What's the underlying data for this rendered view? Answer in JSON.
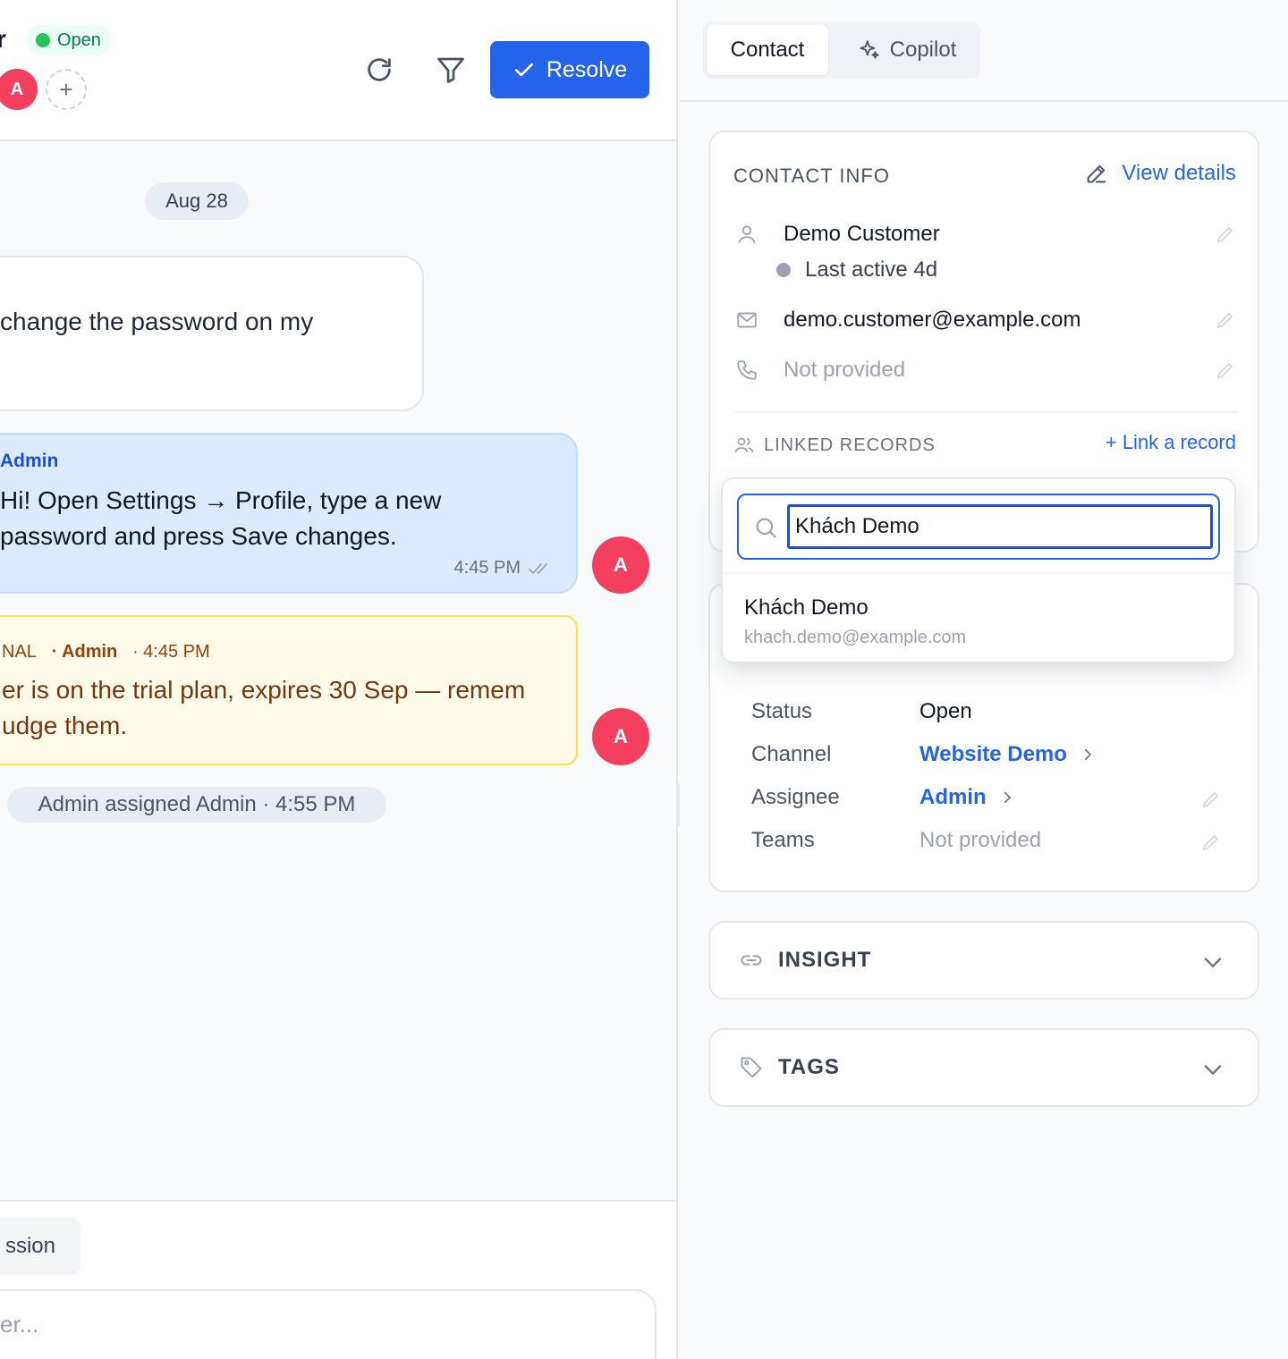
{
  "header": {
    "name_fragment": "r",
    "status": "Open",
    "avatar_initial": "A",
    "add_label": "+",
    "resolve_label": "Resolve"
  },
  "messages": {
    "date_divider": "Aug 28",
    "incoming_text": "change the password on my",
    "outgoing": {
      "sender": "Admin",
      "text": "Hi! Open Settings → Profile, type a new password and press Save changes.",
      "time": "4:45 PM",
      "avatar": "A"
    },
    "note": {
      "label": "NAL",
      "author": "· Admin",
      "time": "· 4:45 PM",
      "line1": "er is on the trial plan, expires 30 Sep — remem",
      "line2": "udge them.",
      "avatar": "A"
    },
    "activity": "Admin assigned Admin · 4:55 PM"
  },
  "composer": {
    "tab_label": "ssion",
    "placeholder": "er..."
  },
  "sidebar": {
    "tabs": [
      {
        "label": "Contact",
        "active": true
      },
      {
        "label": "Copilot",
        "active": false
      }
    ],
    "contact_info": {
      "title": "CONTACT INFO",
      "view_details": "View details",
      "name": "Demo Customer",
      "last_active": "Last active 4d",
      "email": "demo.customer@example.com",
      "phone": "Not provided"
    },
    "linked_records": {
      "title": "LINKED RECORDS",
      "link_action": "+ Link a record",
      "search_value": "Khách Demo",
      "result_name": "Khách Demo",
      "result_email": "khach.demo@example.com"
    },
    "conversation_info": {
      "status_label": "Status",
      "status_value": "Open",
      "channel_label": "Channel",
      "channel_value": "Website Demo",
      "assignee_label": "Assignee",
      "assignee_value": "Admin",
      "teams_label": "Teams",
      "teams_value": "Not provided"
    },
    "insight_title": "INSIGHT",
    "tags_title": "TAGS"
  },
  "colors": {
    "accent": "#2563eb",
    "avatar": "#f43f5e",
    "status_open": "#22c55e",
    "note_bg": "#fefce8",
    "note_border": "#fde047",
    "outgoing_bg": "#dbeafe"
  },
  "icons": [
    "refresh-icon",
    "filter-icon",
    "check-icon",
    "sparkle-icon",
    "pencil-icon",
    "user-icon",
    "mail-icon",
    "phone-icon",
    "users-icon",
    "search-icon",
    "chevron-right-icon",
    "chevron-down-icon",
    "link-icon",
    "tag-icon",
    "double-check-icon"
  ]
}
